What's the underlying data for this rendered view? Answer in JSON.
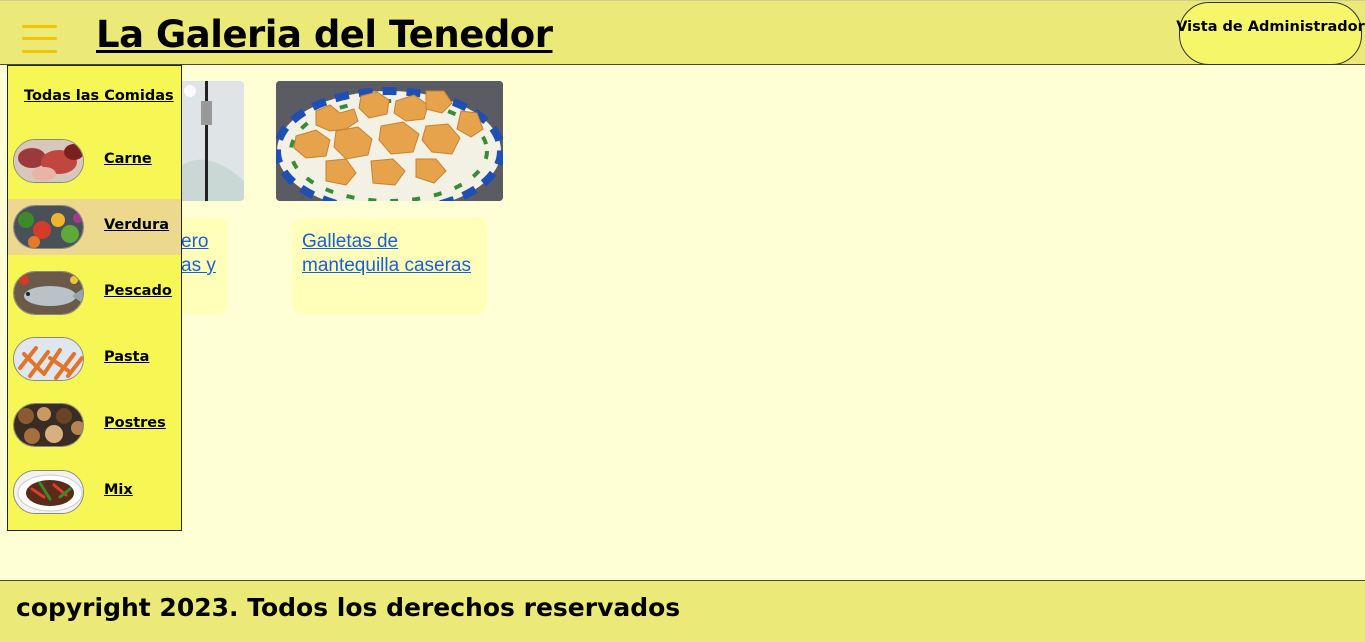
{
  "header": {
    "title": "La Galeria del Tenedor",
    "admin_button": "Vista de Administrador",
    "menu_icon": "hamburger-icon"
  },
  "cards": [
    {
      "title": "ero\nas y",
      "image": "food-photo"
    },
    {
      "title": "Galletas de mantequilla caseras",
      "image": "butter-cookies-photo"
    }
  ],
  "sidemenu": {
    "all_label": "Todas las Comidas",
    "items": [
      {
        "label": "Carne",
        "image": "meat-photo",
        "active": false
      },
      {
        "label": "Verdura",
        "image": "vegetables-photo",
        "active": true
      },
      {
        "label": "Pescado",
        "image": "fish-photo",
        "active": false
      },
      {
        "label": "Pasta",
        "image": "pasta-photo",
        "active": false
      },
      {
        "label": "Postres",
        "image": "desserts-photo",
        "active": false
      },
      {
        "label": "Mix",
        "image": "mix-photo",
        "active": false
      }
    ]
  },
  "footer": {
    "text": "copyright 2023. Todos los derechos reservados"
  },
  "colors": {
    "background": "#ffffd6",
    "header": "#ebe977",
    "menu": "#f6f654",
    "active_item": "#ecd98e",
    "link": "#1a5fd6",
    "hamburger": "#f5c400"
  }
}
